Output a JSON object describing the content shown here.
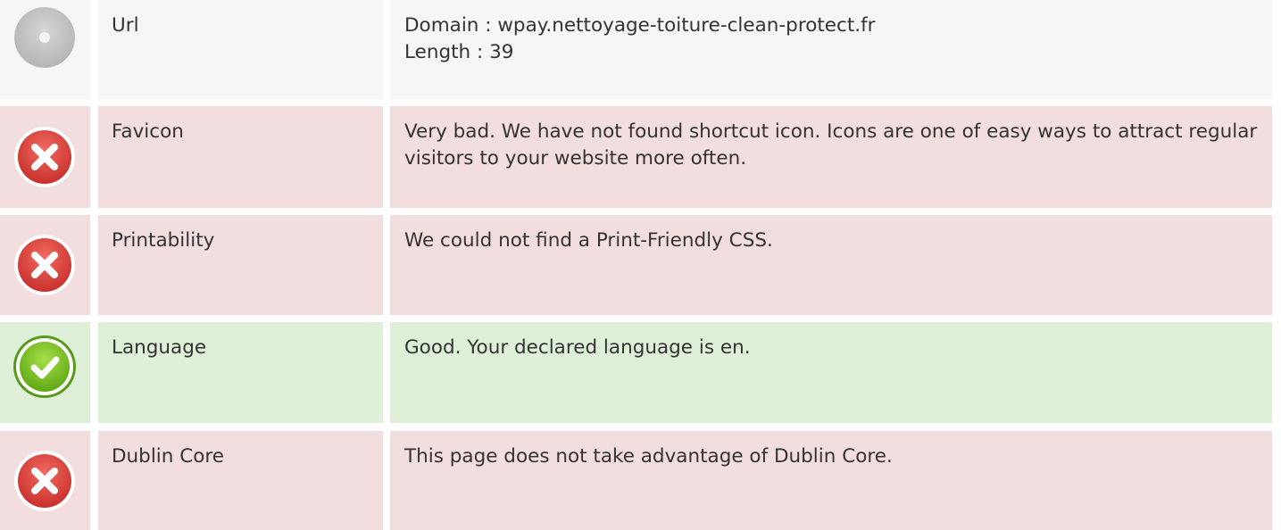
{
  "colors": {
    "neutral_bg": "#f6f6f6",
    "bad_bg": "#f2dede",
    "good_bg": "#dff0d8",
    "bad_icon": "#d9403a",
    "good_icon": "#7cc21f",
    "neutral_icon": "#c2c2c2"
  },
  "rows": [
    {
      "status": "neutral",
      "icon": "info-dot-icon",
      "label": "Url",
      "value": "Domain : wpay.nettoyage-toiture-clean-protect.fr\nLength : 39"
    },
    {
      "status": "bad",
      "icon": "error-x-icon",
      "label": "Favicon",
      "value": "Very bad. We have not found shortcut icon. Icons are one of easy ways to attract regular visitors to your website more often."
    },
    {
      "status": "bad",
      "icon": "error-x-icon",
      "label": "Printability",
      "value": "We could not find a Print-Friendly CSS."
    },
    {
      "status": "good",
      "icon": "success-check-icon",
      "label": "Language",
      "value": "Good. Your declared language is en."
    },
    {
      "status": "bad",
      "icon": "error-x-icon",
      "label": "Dublin Core",
      "value": "This page does not take advantage of Dublin Core."
    }
  ]
}
